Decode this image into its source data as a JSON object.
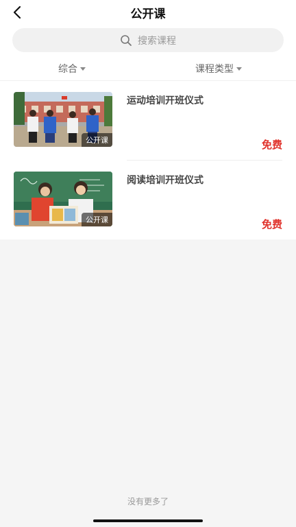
{
  "header": {
    "title": "公开课",
    "back_icon": "chevron-left-icon"
  },
  "search": {
    "placeholder": "搜索课程",
    "icon": "search-icon"
  },
  "filters": [
    {
      "label": "综合",
      "icon": "caret-down-icon"
    },
    {
      "label": "课程类型",
      "icon": "caret-down-icon"
    }
  ],
  "courses": [
    {
      "title": "运动培训开班仪式",
      "badge": "公开课",
      "price": "免费"
    },
    {
      "title": "阅读培训开班仪式",
      "badge": "公开课",
      "price": "免费"
    }
  ],
  "footer": {
    "no_more": "没有更多了"
  },
  "colors": {
    "price": "#e0322b",
    "background": "#f5f5f5"
  }
}
